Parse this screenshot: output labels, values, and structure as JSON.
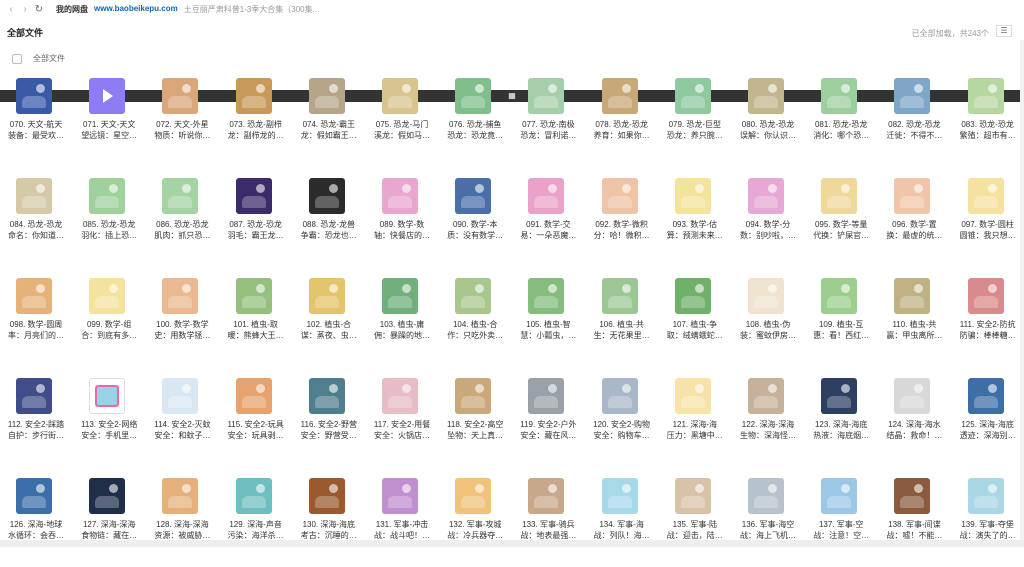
{
  "nav": {
    "back": "‹",
    "forward": "›",
    "refresh": "↻"
  },
  "breadcrumb": [
    "我的网盘",
    "www.baobeikepu.com",
    "土豆丽严肃科普1-3季大合集（300集..."
  ],
  "header": {
    "title": "全部文件",
    "count": "已全部加载，共243个"
  },
  "select_all_label": "全部文件",
  "files": [
    {
      "line1": "070. 天文-航天",
      "line2": "装备：最受欢…",
      "color": "#3a5aa8",
      "play": false
    },
    {
      "line1": "071. 天文-天文",
      "line2": "望远镜：星空…",
      "color": "#8e7cf2",
      "play": true
    },
    {
      "line1": "072. 天文-外星",
      "line2": "物质：听说你…",
      "color": "#d9a77a",
      "play": false
    },
    {
      "line1": "073. 恐龙-副栉",
      "line2": "龙：副栉龙的…",
      "color": "#c79a5a",
      "play": false
    },
    {
      "line1": "074. 恐龙-霸王",
      "line2": "龙：假如霸王…",
      "color": "#b6a589",
      "play": false
    },
    {
      "line1": "075. 恐龙-马门",
      "line2": "溪龙：假如马…",
      "color": "#d8c48e",
      "play": false
    },
    {
      "line1": "076. 恐龙-捕鱼",
      "line2": "恐龙：恐龙竟…",
      "color": "#7fbf8c",
      "play": false
    },
    {
      "line1": "077. 恐龙-南极",
      "line2": "恐龙：冒利诺…",
      "color": "#a5cfa8",
      "play": false
    },
    {
      "line1": "078. 恐龙-恐龙",
      "line2": "养育：如果你…",
      "color": "#c9a878",
      "play": false
    },
    {
      "line1": "079. 恐龙-巨型",
      "line2": "恐龙：养只腕…",
      "color": "#8ec9a0",
      "play": false
    },
    {
      "line1": "080. 恐龙-恐龙",
      "line2": "误解：你认识…",
      "color": "#c2b68e",
      "play": false
    },
    {
      "line1": "081. 恐龙-恐龙",
      "line2": "消化：哪个恐…",
      "color": "#9ccf9d",
      "play": false
    },
    {
      "line1": "082. 恐龙-恐龙",
      "line2": "迁徙：不得不…",
      "color": "#7da6c8",
      "play": false
    },
    {
      "line1": "083. 恐龙-恐龙",
      "line2": "繁殖：超市有…",
      "color": "#b7d7a0",
      "play": false
    },
    {
      "line1": "084. 恐龙-恐龙",
      "line2": "命名：你知道…",
      "color": "#d6c9a8",
      "play": false
    },
    {
      "line1": "085. 恐龙-恐龙",
      "line2": "羽化：插上恐…",
      "color": "#9fd19c",
      "play": false
    },
    {
      "line1": "086. 恐龙-恐龙",
      "line2": "肌肉：抓只恐…",
      "color": "#a6d3a3",
      "play": false
    },
    {
      "line1": "087. 恐龙-恐龙",
      "line2": "羽毛：霸王龙…",
      "color": "#3b2b6a",
      "play": false
    },
    {
      "line1": "088. 恐龙-龙兽",
      "line2": "争霸：恐龙也…",
      "color": "#2b2b2b",
      "play": false
    },
    {
      "line1": "089. 数学-数",
      "line2": "轴：快餐店的…",
      "color": "#e8a6d0",
      "play": false
    },
    {
      "line1": "090. 数学-本",
      "line2": "质：没有数学…",
      "color": "#4a6fa8",
      "play": false
    },
    {
      "line1": "091. 数学-交",
      "line2": "易：一朵恶魔…",
      "color": "#e9a3c8",
      "play": false
    },
    {
      "line1": "092. 数学-微积",
      "line2": "分：哈！微积…",
      "color": "#eec3a6",
      "play": false
    },
    {
      "line1": "093. 数学-估",
      "line2": "算：预测未来…",
      "color": "#f3e49b",
      "play": false
    },
    {
      "line1": "094. 数学-分",
      "line2": "数：别吵啦，…",
      "color": "#e6a8d4",
      "play": false
    },
    {
      "line1": "095. 数学-等量",
      "line2": "代换：铲屎官…",
      "color": "#f0d89a",
      "play": false
    },
    {
      "line1": "096. 数学-置",
      "line2": "换：最虚的统…",
      "color": "#f1c6a8",
      "play": false
    },
    {
      "line1": "097. 数学-圆柱",
      "line2": "圆锥：我只想…",
      "color": "#f5e2a0",
      "play": false
    },
    {
      "line1": "098. 数学-圆周",
      "line2": "率：月亮们的…",
      "color": "#e6b27a",
      "play": false
    },
    {
      "line1": "099. 数学-组",
      "line2": "合：到底有多…",
      "color": "#f4e39c",
      "play": false
    },
    {
      "line1": "100. 数学-数学",
      "line2": "史：用数学拯…",
      "color": "#eab98f",
      "play": false
    },
    {
      "line1": "101. 植虫-取",
      "line2": "暖：熊蜂大王…",
      "color": "#95c07d",
      "play": false
    },
    {
      "line1": "102. 植虫-合",
      "line2": "谋：蒸夜、虫…",
      "color": "#e3c46a",
      "play": false
    },
    {
      "line1": "103. 植虫-庸",
      "line2": "佣：暴躁的地…",
      "color": "#6fb07c",
      "play": false
    },
    {
      "line1": "104. 植虫-合",
      "line2": "作：只吃外卖…",
      "color": "#a9c68c",
      "play": false
    },
    {
      "line1": "105. 植虫-智",
      "line2": "慧：小瓢虫，…",
      "color": "#86bd7f",
      "play": false
    },
    {
      "line1": "106. 植虫-共",
      "line2": "生：无花果里…",
      "color": "#9dc695",
      "play": false
    },
    {
      "line1": "107. 植虫-争",
      "line2": "取：绒螨蛾蛇…",
      "color": "#6fb16a",
      "play": false
    },
    {
      "line1": "108. 植虫-伪",
      "line2": "装：蜜蚊伊房…",
      "color": "#f0e3cf",
      "play": false
    },
    {
      "line1": "109. 植虫-互",
      "line2": "惠：看！西红…",
      "color": "#9ccf8d",
      "play": false
    },
    {
      "line1": "110. 植虫-共",
      "line2": "赢：甲虫离所…",
      "color": "#c1b284",
      "play": false
    },
    {
      "line1": "111. 安全2-防抗",
      "line2": "防骗：棒棒糖…",
      "color": "#d98b8b",
      "play": false
    },
    {
      "line1": "112. 安全2-踩踏",
      "line2": "自护：步行街…",
      "color": "#3f4d8a",
      "play": false
    },
    {
      "line1": "113. 安全2-网络",
      "line2": "安全：手机里…",
      "color": "#pad",
      "play": false,
      "pad": true
    },
    {
      "line1": "114. 安全2-灭蚊",
      "line2": "安全：和蚊子…",
      "color": "#d9e7f2",
      "play": false
    },
    {
      "line1": "115. 安全2-玩具",
      "line2": "安全：玩具剥…",
      "color": "#e6a36e",
      "play": false
    },
    {
      "line1": "116. 安全2-野营",
      "line2": "安全：野营受…",
      "color": "#4f7f8e",
      "play": false
    },
    {
      "line1": "117. 安全2-用餐",
      "line2": "安全：火锅店…",
      "color": "#e7bcc4",
      "play": false
    },
    {
      "line1": "118. 安全2-高空",
      "line2": "坠物：天上真…",
      "color": "#c9a979",
      "play": false
    },
    {
      "line1": "119. 安全2-户外",
      "line2": "安全：藏在风…",
      "color": "#9aa0a8",
      "play": false
    },
    {
      "line1": "120. 安全2-购物",
      "line2": "安全：购物车…",
      "color": "#a9b8c8",
      "play": false
    },
    {
      "line1": "121. 深海-海",
      "line2": "压力：黑塘中…",
      "color": "#f7e3a8",
      "play": false
    },
    {
      "line1": "122. 深海-深海",
      "line2": "生物：深海怪…",
      "color": "#c6b29a",
      "play": false
    },
    {
      "line1": "123. 深海-海底",
      "line2": "热液：海底烟…",
      "color": "#2e3f63",
      "play": false
    },
    {
      "line1": "124. 深海-海水",
      "line2": "结晶：救命！…",
      "color": "#d8d8d8",
      "play": false
    },
    {
      "line1": "125. 深海-海底",
      "line2": "透迹：深海别…",
      "color": "#3d6fa6",
      "play": false
    },
    {
      "line1": "126. 深海-地球",
      "line2": "水循环：会吞…",
      "color": "#3c6fa8",
      "play": false
    },
    {
      "line1": "127. 深海-深海",
      "line2": "食物链：藏在…",
      "color": "#1f2f4a",
      "play": false
    },
    {
      "line1": "128. 深海-深海",
      "line2": "资源：被威胁…",
      "color": "#e6b07a",
      "play": false
    },
    {
      "line1": "129. 深海-声音",
      "line2": "污染：海洋杀…",
      "color": "#6fbfc0",
      "play": false
    },
    {
      "line1": "130. 深海-海底",
      "line2": "考古：沉睡的…",
      "color": "#9a5a2e",
      "play": false
    },
    {
      "line1": "131. 军事-冲击",
      "line2": "战：战斗吧！…",
      "color": "#c08fcf",
      "play": false
    },
    {
      "line1": "132. 军事-攻城",
      "line2": "战：冷兵器夺…",
      "color": "#f0c27a",
      "play": false
    },
    {
      "line1": "133. 军事-骑兵",
      "line2": "战：地表最强…",
      "color": "#c8a88a",
      "play": false
    },
    {
      "line1": "134. 军事-海",
      "line2": "战：列队！海…",
      "color": "#a8d9e8",
      "play": false
    },
    {
      "line1": "135. 军事-陆",
      "line2": "战：迎击，陆…",
      "color": "#d8c3a8",
      "play": false
    },
    {
      "line1": "136. 军事-海空",
      "line2": "战：海上飞机…",
      "color": "#b7c3cc",
      "play": false
    },
    {
      "line1": "137. 军事-空",
      "line2": "战：注意！空…",
      "color": "#9cc8e8",
      "play": false
    },
    {
      "line1": "138. 军事-间谍",
      "line2": "战：嘘！不能…",
      "color": "#8a5b3e",
      "play": false
    },
    {
      "line1": "139. 军事-夺堡",
      "line2": "战：演失了的…",
      "color": "#a9d7e6",
      "play": false
    }
  ]
}
